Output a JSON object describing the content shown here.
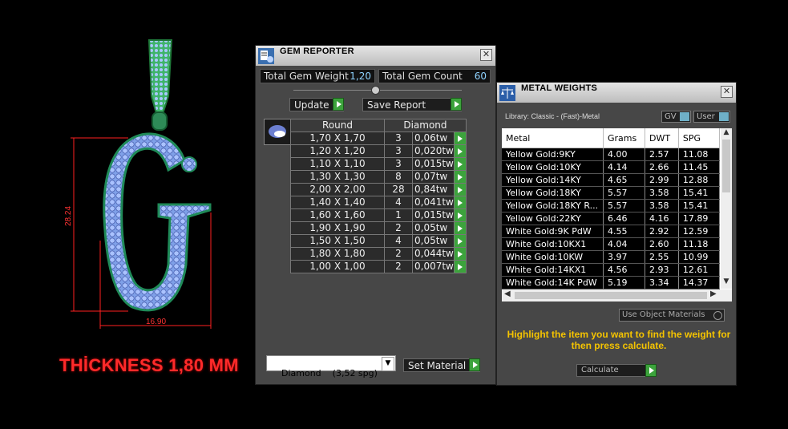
{
  "viewport": {
    "dimension_height": "28.24",
    "dimension_width": "16.90",
    "thickness_label": "THİCKNESS 1,80 MM"
  },
  "gem_reporter": {
    "title": "GEM REPORTER",
    "total_weight_label": "Total Gem Weight",
    "total_weight_value": "1,20",
    "total_count_label": "Total Gem Count",
    "total_count_value": "60",
    "update_label": "Update",
    "save_report_label": "Save Report",
    "col_shape": "Round",
    "col_material": "Diamond",
    "rows": [
      {
        "size": "1,70 X 1,70",
        "count": "3",
        "weight": "0,06tw"
      },
      {
        "size": "1,20 X 1,20",
        "count": "3",
        "weight": "0,020tw"
      },
      {
        "size": "1,10 X 1,10",
        "count": "3",
        "weight": "0,015tw"
      },
      {
        "size": "1,30 X 1,30",
        "count": "8",
        "weight": "0,07tw"
      },
      {
        "size": "2,00 X 2,00",
        "count": "28",
        "weight": "0,84tw"
      },
      {
        "size": "1,40 X 1,40",
        "count": "4",
        "weight": "0,041tw"
      },
      {
        "size": "1,60 X 1,60",
        "count": "1",
        "weight": "0,015tw"
      },
      {
        "size": "1,90 X 1,90",
        "count": "2",
        "weight": "0,05tw"
      },
      {
        "size": "1,50 X 1,50",
        "count": "4",
        "weight": "0,05tw"
      },
      {
        "size": "1,80 X 1,80",
        "count": "2",
        "weight": "0,044tw"
      },
      {
        "size": "1,00 X 1,00",
        "count": "2",
        "weight": "0,007tw"
      }
    ],
    "material_select": "Diamond    (3,52 spg)",
    "set_material_label": "Set Material"
  },
  "metal_weights": {
    "title": "METAL WEIGHTS",
    "library": "Library: Classic - (Fast)-Metal",
    "gv_label": "GV",
    "user_label": "User",
    "columns": [
      "Metal",
      "Grams",
      "DWT",
      "SPG"
    ],
    "rows": [
      [
        "Yellow Gold:9KY",
        "4.00",
        "2.57",
        "11.08"
      ],
      [
        "Yellow Gold:10KY",
        "4.14",
        "2.66",
        "11.45"
      ],
      [
        "Yellow Gold:14KY",
        "4.65",
        "2.99",
        "12.88"
      ],
      [
        "Yellow Gold:18KY",
        "5.57",
        "3.58",
        "15.41"
      ],
      [
        "Yellow Gold:18KY R...",
        "5.57",
        "3.58",
        "15.41"
      ],
      [
        "Yellow Gold:22KY",
        "6.46",
        "4.16",
        "17.89"
      ],
      [
        "White Gold:9K PdW",
        "4.55",
        "2.92",
        "12.59"
      ],
      [
        "White Gold:10KX1",
        "4.04",
        "2.60",
        "11.18"
      ],
      [
        "White Gold:10KW",
        "3.97",
        "2.55",
        "10.99"
      ],
      [
        "White Gold:14KX1",
        "4.56",
        "2.93",
        "12.61"
      ],
      [
        "White Gold:14K PdW",
        "5.19",
        "3.34",
        "14.37"
      ]
    ],
    "use_object_materials": "Use Object Materials",
    "hint": "Highlight the item you want to find the weight for then press calculate.",
    "calculate_label": "Calculate"
  }
}
